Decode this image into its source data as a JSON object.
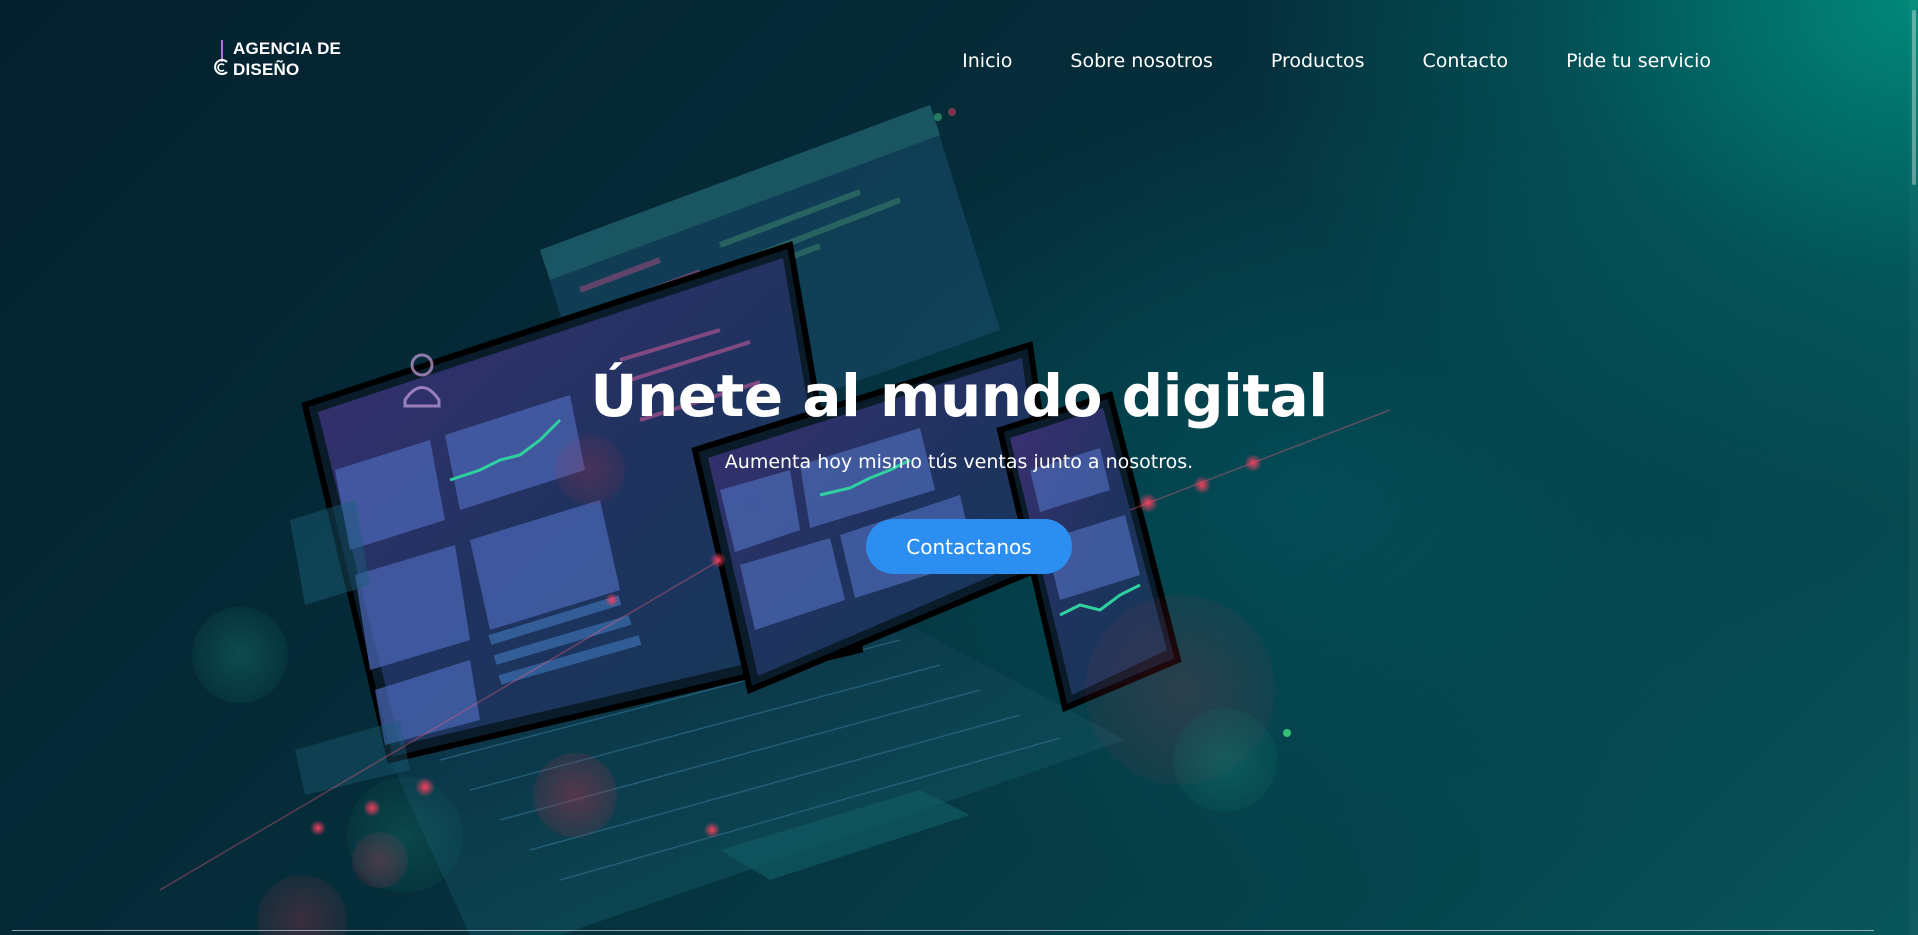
{
  "logo": {
    "line1": "AGENCIA DE",
    "line2": "DISEÑO",
    "icon": "logo-mark-icon"
  },
  "nav": {
    "items": [
      {
        "label": "Inicio"
      },
      {
        "label": "Sobre nosotros"
      },
      {
        "label": "Productos"
      },
      {
        "label": "Contacto"
      },
      {
        "label": "Pide tu servicio"
      }
    ]
  },
  "hero": {
    "title": "Únete al mundo digital",
    "subtitle": "Aumenta hoy mismo tús ventas junto a nosotros.",
    "cta_label": "Contactanos"
  },
  "colors": {
    "accent": "#2b8ef0",
    "logo_accent": "#b070e0",
    "background_dark": "#041a26",
    "background_teal": "#009684"
  }
}
